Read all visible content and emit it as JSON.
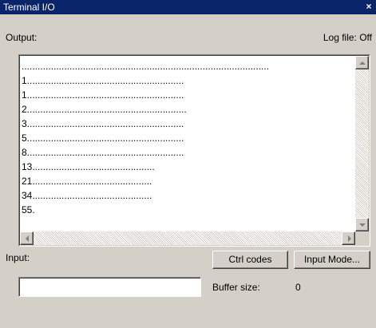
{
  "window": {
    "title": "Terminal I/O",
    "close_glyph": "×"
  },
  "output": {
    "label": "Output:",
    "log_file": "Log file:  Off",
    "lines": [
      ".............................................................................................",
      "1...........................................................",
      "1...........................................................",
      "2............................................................",
      "3...........................................................",
      "5...........................................................",
      "8...........................................................",
      "13..............................................",
      "21.............................................",
      "34.............................................",
      "55."
    ]
  },
  "input": {
    "label": "Input:",
    "value": "",
    "placeholder": ""
  },
  "buttons": {
    "ctrl_codes": "Ctrl codes",
    "input_mode": "Input Mode..."
  },
  "buffer": {
    "label": "Buffer size:",
    "value": "0"
  },
  "icons": {
    "close": "close-icon",
    "scroll_up": "arrow-up-icon",
    "scroll_down": "arrow-down-icon",
    "scroll_left": "arrow-left-icon",
    "scroll_right": "arrow-right-icon"
  },
  "colors": {
    "titlebar": "#0a246a",
    "face": "#d4d0c8"
  }
}
